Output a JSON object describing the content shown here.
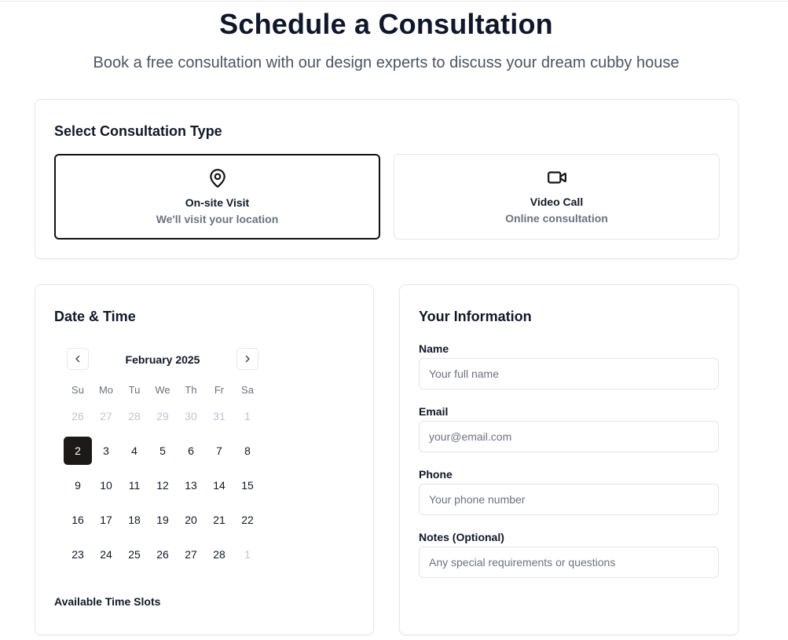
{
  "header": {
    "title": "Schedule a Consultation",
    "subtitle": "Book a free consultation with our design experts to discuss your dream cubby house"
  },
  "consultation_type": {
    "title": "Select Consultation Type",
    "options": [
      {
        "title": "On-site Visit",
        "description": "We'll visit your location",
        "icon": "map-pin-icon",
        "selected": true
      },
      {
        "title": "Video Call",
        "description": "Online consultation",
        "icon": "video-camera-icon",
        "selected": false
      }
    ]
  },
  "date_time": {
    "title": "Date & Time",
    "month": "February 2025",
    "weekdays": [
      "Su",
      "Mo",
      "Tu",
      "We",
      "Th",
      "Fr",
      "Sa"
    ],
    "days": [
      {
        "label": "26",
        "outside": true
      },
      {
        "label": "27",
        "outside": true
      },
      {
        "label": "28",
        "outside": true
      },
      {
        "label": "29",
        "outside": true
      },
      {
        "label": "30",
        "outside": true
      },
      {
        "label": "31",
        "outside": true
      },
      {
        "label": "1",
        "outside": true
      },
      {
        "label": "2",
        "selected": true
      },
      {
        "label": "3"
      },
      {
        "label": "4"
      },
      {
        "label": "5"
      },
      {
        "label": "6"
      },
      {
        "label": "7"
      },
      {
        "label": "8"
      },
      {
        "label": "9"
      },
      {
        "label": "10"
      },
      {
        "label": "11"
      },
      {
        "label": "12"
      },
      {
        "label": "13"
      },
      {
        "label": "14"
      },
      {
        "label": "15"
      },
      {
        "label": "16"
      },
      {
        "label": "17"
      },
      {
        "label": "18"
      },
      {
        "label": "19"
      },
      {
        "label": "20"
      },
      {
        "label": "21"
      },
      {
        "label": "22"
      },
      {
        "label": "23"
      },
      {
        "label": "24"
      },
      {
        "label": "25"
      },
      {
        "label": "26"
      },
      {
        "label": "27"
      },
      {
        "label": "28"
      },
      {
        "label": "1",
        "outside": true
      }
    ],
    "slots_label": "Available Time Slots"
  },
  "your_info": {
    "title": "Your Information",
    "fields": {
      "name": {
        "label": "Name",
        "placeholder": "Your full name",
        "value": ""
      },
      "email": {
        "label": "Email",
        "placeholder": "your@email.com",
        "value": ""
      },
      "phone": {
        "label": "Phone",
        "placeholder": "Your phone number",
        "value": ""
      },
      "notes": {
        "label": "Notes (Optional)",
        "placeholder": "Any special requirements or questions",
        "value": ""
      }
    }
  },
  "colors": {
    "selected_day_bg": "#1c1917",
    "selected_border": "#111111",
    "muted_text": "#6b7280",
    "card_border": "#e5e7eb"
  }
}
